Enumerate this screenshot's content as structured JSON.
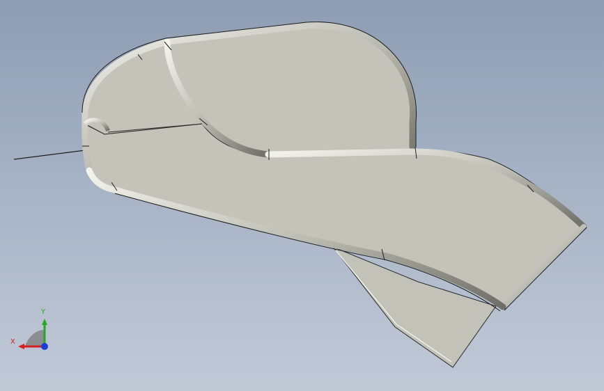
{
  "viewport": {
    "background_top": "#8e9db3",
    "background_bottom": "#c1c9d7"
  },
  "model": {
    "face_color": "#c3c3b9",
    "edge_color": "#1e1e1e"
  },
  "triad": {
    "x_label": "X",
    "y_label": "Y",
    "x_color": "#d42020",
    "y_color": "#22a822",
    "z_color": "#1a3dd6"
  }
}
